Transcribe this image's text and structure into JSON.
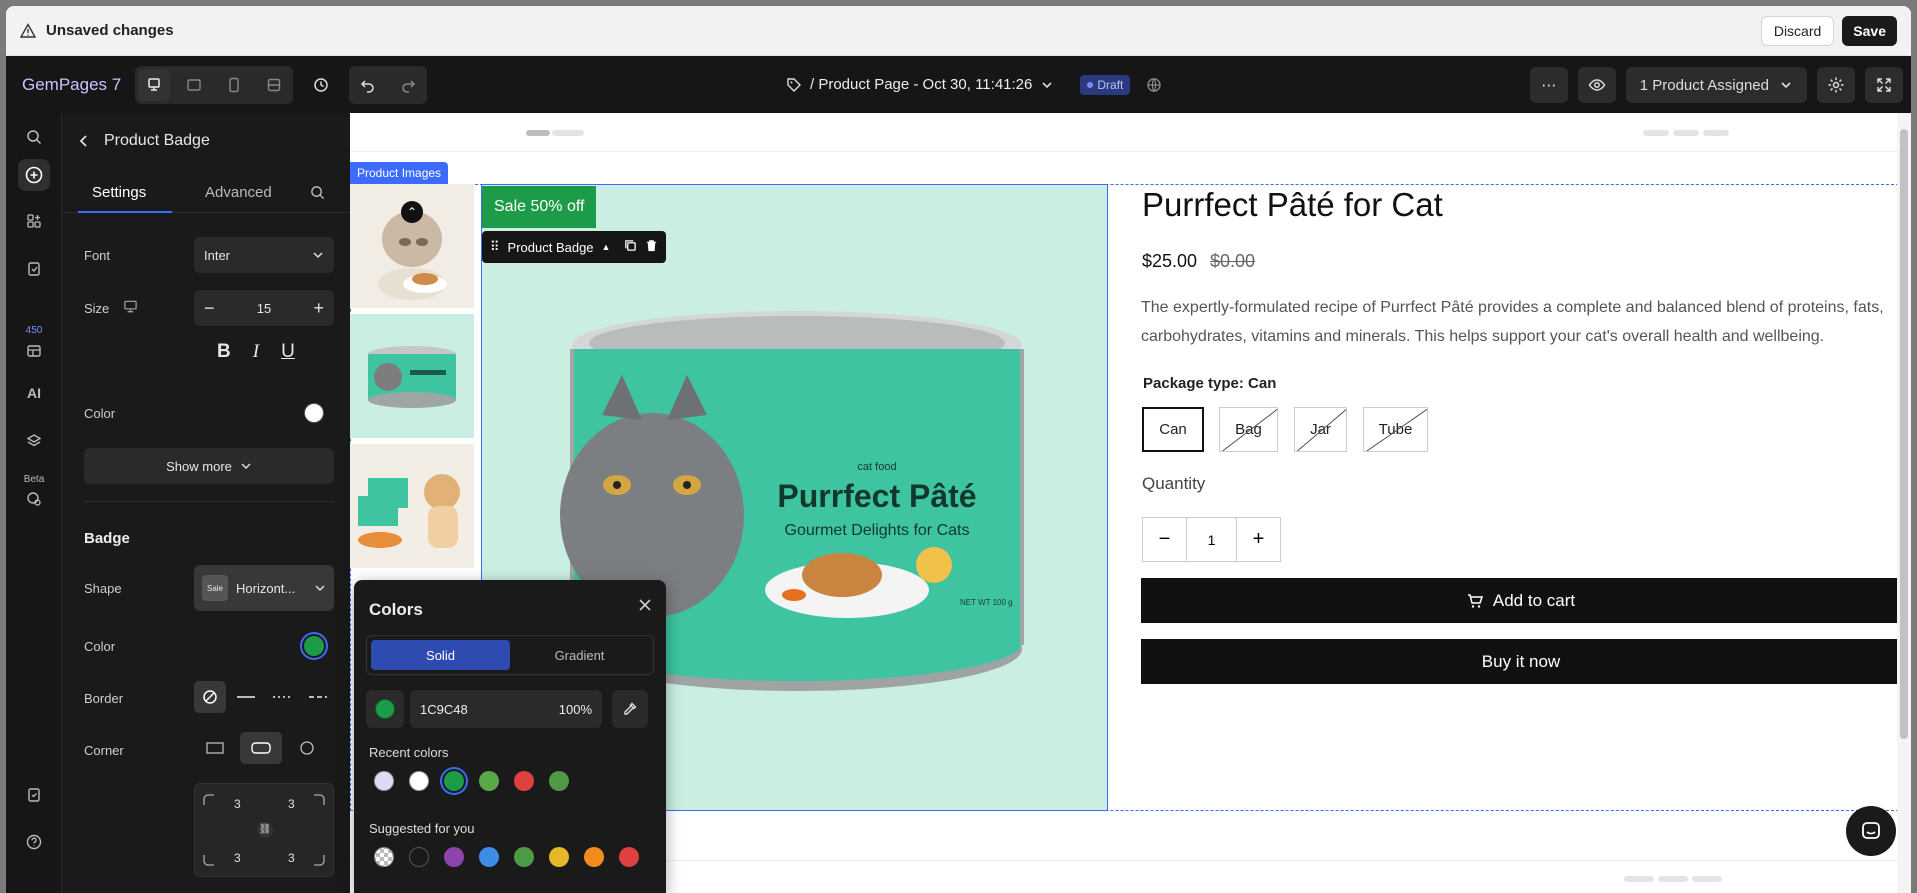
{
  "topbar": {
    "title": "Unsaved changes",
    "discard": "Discard",
    "save": "Save"
  },
  "header": {
    "logo": "GemPages 7",
    "page_title": "/ Product Page - Oct 30, 11:41:26",
    "status": "Draft",
    "assigned": "1 Product Assigned"
  },
  "rail": {
    "badge": "450",
    "beta": "Beta"
  },
  "panel": {
    "title": "Product Badge",
    "tabs": [
      "Settings",
      "Advanced"
    ],
    "font_label": "Font",
    "font_value": "Inter",
    "size_label": "Size",
    "size_value": "15",
    "color_label": "Color",
    "text_color": "#ffffff",
    "show_more": "Show more",
    "badge_section": "Badge",
    "shape_label": "Shape",
    "shape_value": "Horizont...",
    "shape_thumb": "Sale",
    "badge_color_label": "Color",
    "badge_color": "#1c9c48",
    "border_label": "Border",
    "corner_label": "Corner",
    "corners": [
      "3",
      "3",
      "3",
      "3"
    ]
  },
  "canvas": {
    "product_images_tag": "Product Images",
    "badge_text": "Sale 50% off",
    "toolbar_label": "Product Badge",
    "product_title": "Purrfect Pâté for Cat",
    "price": "$25.00",
    "old_price": "$0.00",
    "description": "The expertly-formulated recipe of Purrfect Pâté provides a complete and balanced blend of proteins, fats, carbohydrates, vitamins and minerals. This helps support your cat's overall health and wellbeing.",
    "package_label": "Package type: Can",
    "options": [
      "Can",
      "Bag",
      "Jar",
      "Tube"
    ],
    "quantity_label": "Quantity",
    "quantity": "1",
    "add_to_cart": "Add to cart",
    "buy_now": "Buy it now",
    "can_brand_small": "cat food",
    "can_brand": "Purrfect Pâté",
    "can_tagline": "Gourmet Delights for Cats",
    "can_weight": "NET WT 100 g"
  },
  "colors_popup": {
    "title": "Colors",
    "tabs": [
      "Solid",
      "Gradient"
    ],
    "hex": "1C9C48",
    "opacity": "100%",
    "recent_label": "Recent colors",
    "recent": [
      "#e3d9f7",
      "#ffffff",
      "#1c9c48",
      "#5aa84a",
      "#e04040",
      "#4e9a45"
    ],
    "suggested_label": "Suggested for you",
    "suggested": [
      "transparent",
      "#1a1a1a",
      "#8e44ad",
      "#3b8de6",
      "#4e9a45",
      "#e5b82a",
      "#f28c1e",
      "#e04040"
    ]
  }
}
